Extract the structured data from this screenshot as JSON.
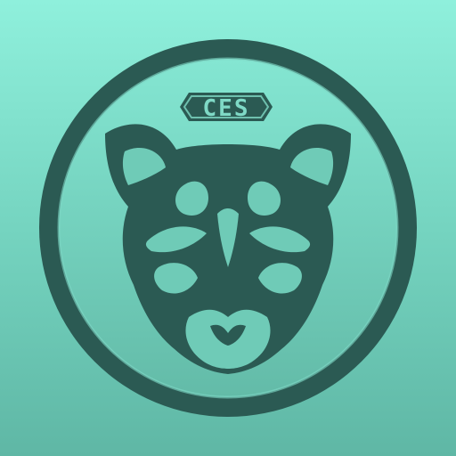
{
  "icon": {
    "name": "cougar-emblem-icon",
    "badge_text": "CES"
  },
  "colors": {
    "background_top": "#8ff0dc",
    "background_bottom": "#5fb7a5",
    "emblem_dark": "#2b5a53",
    "emblem_fill": "#6fcbb7"
  }
}
